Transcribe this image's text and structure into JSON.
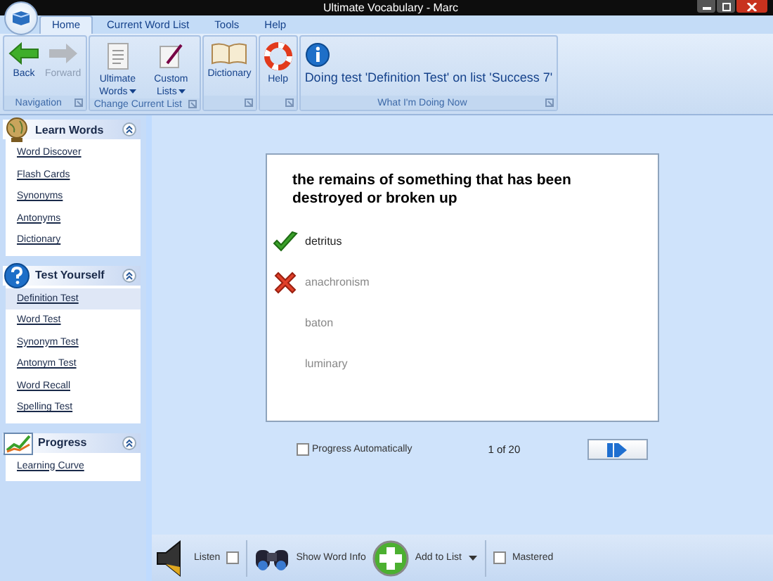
{
  "window": {
    "title": "Ultimate Vocabulary - Marc"
  },
  "tabs": [
    {
      "label": "Home",
      "selected": true
    },
    {
      "label": "Current Word List",
      "selected": false
    },
    {
      "label": "Tools",
      "selected": false
    },
    {
      "label": "Help",
      "selected": false
    }
  ],
  "ribbon": [
    {
      "label": "Navigation",
      "buttons": [
        {
          "label": "Back",
          "disabled": false,
          "dropdown": false
        },
        {
          "label": "Forward",
          "disabled": true,
          "dropdown": false
        }
      ]
    },
    {
      "label": "Change Current List",
      "buttons": [
        {
          "label": "Ultimate Words",
          "disabled": false,
          "dropdown": true
        },
        {
          "label": "Custom Lists",
          "disabled": false,
          "dropdown": true
        }
      ]
    },
    {
      "buttons": [
        {
          "label": "Dictionary",
          "disabled": false,
          "dropdown": false
        }
      ]
    },
    {
      "buttons": [
        {
          "label": "Help",
          "disabled": false,
          "dropdown": false
        }
      ]
    },
    {
      "label": "What I'm Doing Now",
      "status": "Doing test 'Definition Test' on list 'Success 7'"
    }
  ],
  "sidebar": [
    {
      "title": "Learn Words",
      "items": [
        {
          "label": "Word Discover",
          "selected": false
        },
        {
          "label": "Flash Cards",
          "selected": false
        },
        {
          "label": "Synonyms",
          "selected": false
        },
        {
          "label": "Antonyms",
          "selected": false
        },
        {
          "label": "Dictionary",
          "selected": false
        }
      ]
    },
    {
      "title": "Test Yourself",
      "items": [
        {
          "label": "Definition Test",
          "selected": true
        },
        {
          "label": "Word Test",
          "selected": false
        },
        {
          "label": "Synonym Test",
          "selected": false
        },
        {
          "label": "Antonym Test",
          "selected": false
        },
        {
          "label": "Word Recall",
          "selected": false
        },
        {
          "label": "Spelling Test",
          "selected": false
        }
      ]
    },
    {
      "title": "Progress",
      "items": [
        {
          "label": "Learning Curve",
          "selected": false
        }
      ]
    }
  ],
  "question": {
    "prompt": "the remains of something that has been destroyed or broken up",
    "answers": [
      {
        "text": "detritus",
        "kind": "correct"
      },
      {
        "text": "anachronism",
        "kind": "wrong"
      },
      {
        "text": "baton",
        "kind": "plain"
      },
      {
        "text": "luminary",
        "kind": "plain"
      }
    ]
  },
  "progress_auto": {
    "label": "Progress Automatically",
    "checked": false
  },
  "counter": "1 of 20",
  "bottom_bar": {
    "listen": {
      "label": "Listen",
      "checked": false
    },
    "show_word_info": "Show Word Info",
    "add_to_list": "Add to List",
    "mastered": {
      "label": "Mastered",
      "checked": false
    }
  }
}
